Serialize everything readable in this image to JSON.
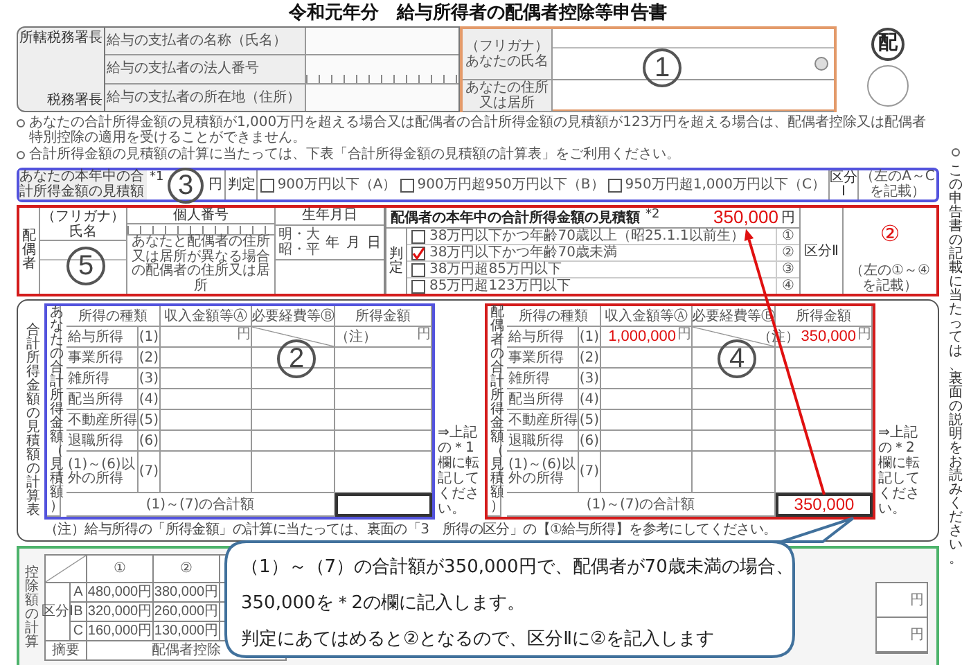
{
  "title": "令和元年分　給与所得者の配偶者控除等申告書",
  "header": {
    "office_labels": [
      "所轄税務署長",
      "税務署長"
    ],
    "payer_fields": [
      {
        "label": "給与の支払者の名称（氏名）",
        "kind": "text"
      },
      {
        "label": "給与の支払者の法人番号",
        "kind": "digits"
      },
      {
        "label": "給与の支払者の所在地（住所）",
        "kind": "text"
      }
    ],
    "your_fields": [
      {
        "furigana": "（フリガナ）",
        "label": "あなたの氏名",
        "seal": true
      },
      {
        "label": "あなたの住所又は居所",
        "seal": false
      }
    ],
    "form_mark": "配",
    "marker": "1"
  },
  "notes": [
    "あなたの合計所得金額の見積額が1,000万円を超える場合又は配偶者の合計所得金額の見積額が123万円を超える場合は、配偶者控除又は配偶者特別控除の適用を受けることができません。",
    "合計所得金額の見積額の計算に当たっては、下表「合計所得金額の見積額の計算表」をご利用ください。"
  ],
  "own_income": {
    "label": "あなたの本年中の合計所得金額の見積額",
    "ref": "*1",
    "unit": "円",
    "judge_label": "判定",
    "options": [
      {
        "label": "900万円以下（A）",
        "checked": false
      },
      {
        "label": "900万円超950万円以下（B）",
        "checked": false
      },
      {
        "label": "950万円超1,000万円以下（C）",
        "checked": false
      }
    ],
    "category_label": "区分Ⅰ",
    "category_hint": "（左のA～Cを記載）",
    "marker": "3"
  },
  "spouse": {
    "side_label": "配偶者",
    "furigana": "（フリガナ）",
    "name_label": "氏名",
    "number_label": "個人番号",
    "birth_label": "生年月日",
    "eras": [
      "明・大",
      "昭・平"
    ],
    "date_units": [
      "年",
      "月",
      "日"
    ],
    "address_label": "あなたと配偶者の住所又は居所が異なる場合の配偶者の住所又は居所",
    "income_label": "配偶者の本年中の合計所得金額の見積額",
    "ref": "*2",
    "income_value": "350,000",
    "unit": "円",
    "judge_label": "判定",
    "options": [
      {
        "label": "38万円以下かつ年齢70歳以上（昭25.1.1以前生）",
        "number": "①",
        "checked": false
      },
      {
        "label": "38万円以下かつ年齢70歳未満",
        "number": "②",
        "checked": true
      },
      {
        "label": "38万円超85万円以下",
        "number": "③",
        "checked": false
      },
      {
        "label": "85万円超123万円以下",
        "number": "④",
        "checked": false
      }
    ],
    "category_label": "区分Ⅱ",
    "category_value": "②",
    "category_hint": "（左の①～④を記載）",
    "marker": "5"
  },
  "calc": {
    "title": "合計所得金額の見積額の計算表",
    "tables": [
      {
        "side_label": "あなたの合計所得金額（見積額）",
        "columns": [
          "所得の種類",
          "収入金額等Ⓐ",
          "必要経費等Ⓑ",
          "所得金額"
        ],
        "rows": [
          {
            "name": "給与所得",
            "no": "(1)",
            "revenue_unit": "円",
            "income_note": "（注）",
            "income_unit": "円"
          },
          {
            "name": "事業所得",
            "no": "(2)"
          },
          {
            "name": "雑所得",
            "no": "(3)"
          },
          {
            "name": "配当所得",
            "no": "(4)"
          },
          {
            "name": "不動産所得",
            "no": "(5)"
          },
          {
            "name": "退職所得",
            "no": "(6)"
          },
          {
            "name": "(1)～(6)以外の所得",
            "no": "(7)"
          }
        ],
        "total_label": "(1)～(7)の合計額",
        "transfer_note": "⇒上記の＊1欄に転記してください。",
        "marker": "2"
      },
      {
        "side_label": "配偶者の合計所得金額（見積額）",
        "columns": [
          "所得の種類",
          "収入金額等Ⓐ",
          "必要経費等Ⓑ",
          "所得金額"
        ],
        "rows": [
          {
            "name": "給与所得",
            "no": "(1)",
            "revenue": "1,000,000",
            "revenue_unit": "円",
            "income_note": "（注）",
            "income": "350,000",
            "income_unit": "円"
          },
          {
            "name": "事業所得",
            "no": "(2)"
          },
          {
            "name": "雑所得",
            "no": "(3)"
          },
          {
            "name": "配当所得",
            "no": "(4)"
          },
          {
            "name": "不動産所得",
            "no": "(5)"
          },
          {
            "name": "退職所得",
            "no": "(6)"
          },
          {
            "name": "(1)～(6)以外の所得",
            "no": "(7)"
          }
        ],
        "total_label": "(1)～(7)の合計額",
        "total": "350,000",
        "transfer_note": "⇒上記の＊2欄に転記してください。",
        "marker": "4"
      }
    ],
    "footnote": "（注）給与所得の「所得金額」の計算に当たっては、裏面の「3　所得の区分」の【①給与所得】を参考にしてください。"
  },
  "deduction": {
    "side_label": "控除額の計算",
    "group_label": "区分Ⅰ",
    "columns": [
      "①",
      "②"
    ],
    "rows": [
      {
        "key": "A",
        "values": [
          "480,000円",
          "380,000円"
        ]
      },
      {
        "key": "B",
        "values": [
          "320,000円",
          "260,000円"
        ]
      },
      {
        "key": "C",
        "values": [
          "160,000円",
          "130,000円"
        ]
      }
    ],
    "yen_cells": [
      "円",
      "円"
    ],
    "summary_label": "摘要",
    "summary_value": "配偶者控除"
  },
  "side_note": "この申告書の記載に当たっては、裏面の説明をお読みください。",
  "callout": [
    "（1）～（7）の合計額が350,000円で、配偶者が70歳未満の場合、",
    "350,000を＊2の欄に記入します。",
    "判定にあてはめると②となるので、区分Ⅱに②を記入します"
  ]
}
